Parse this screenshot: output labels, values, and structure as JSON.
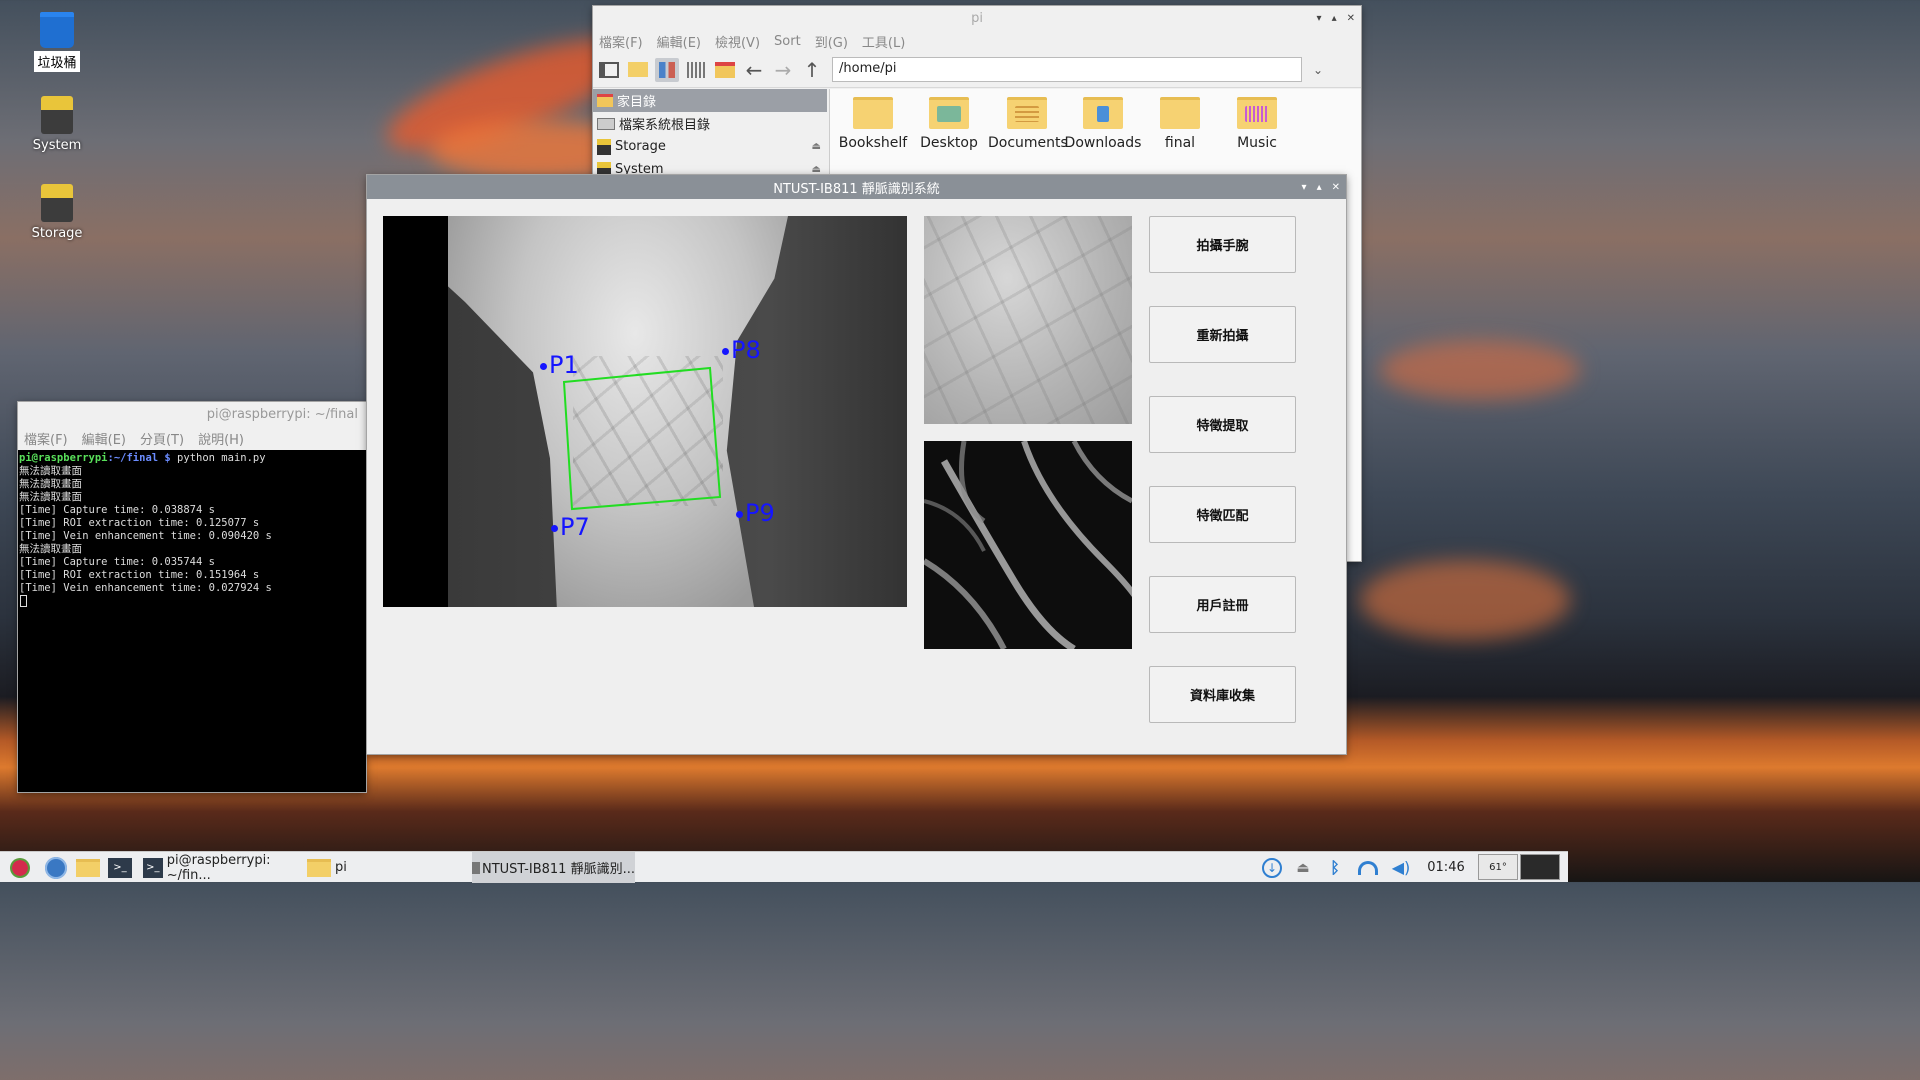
{
  "desktop": {
    "icons": [
      {
        "label": "垃圾桶"
      },
      {
        "label": "System"
      },
      {
        "label": "Storage"
      }
    ]
  },
  "file_manager": {
    "title": "pi",
    "menu": [
      "檔案(F)",
      "編輯(E)",
      "檢視(V)",
      "Sort",
      "到(G)",
      "工具(L)"
    ],
    "path": "/home/pi",
    "sidebar": [
      {
        "label": "家目錄"
      },
      {
        "label": "檔案系統根目錄"
      },
      {
        "label": "Storage"
      },
      {
        "label": "System"
      }
    ],
    "files": [
      {
        "label": "Bookshelf"
      },
      {
        "label": "Desktop"
      },
      {
        "label": "Documents"
      },
      {
        "label": "Downloads"
      },
      {
        "label": "final"
      },
      {
        "label": "Music"
      }
    ]
  },
  "terminal": {
    "title": "pi@raspberrypi: ~/final",
    "menu": [
      "檔案(F)",
      "編輯(E)",
      "分頁(T)",
      "說明(H)"
    ],
    "prompt_user": "pi@raspberrypi",
    "prompt_path": ":~/final $",
    "command": " python main.py",
    "lines": [
      "無法讀取畫面",
      "無法讀取畫面",
      "無法讀取畫面",
      "[Time] Capture time: 0.038874 s",
      "[Time] ROI extraction time: 0.125077 s",
      "[Time] Vein enhancement time: 0.090420 s",
      "無法讀取畫面",
      "[Time] Capture time: 0.035744 s",
      "[Time] ROI extraction time: 0.151964 s",
      "[Time] Vein enhancement time: 0.027924 s"
    ]
  },
  "app": {
    "title": "NTUST-IB811 靜脈識別系統",
    "points": {
      "p1": "P1",
      "p7": "P7",
      "p8": "P8",
      "p9": "P9"
    },
    "buttons": {
      "capture": "拍攝手腕",
      "retake": "重新拍攝",
      "extract": "特徵提取",
      "match": "特徵匹配",
      "register": "用戶註冊",
      "collect": "資料庫收集"
    }
  },
  "taskbar": {
    "tasks": [
      {
        "label": "pi@raspberrypi: ~/fin..."
      },
      {
        "label": "pi"
      },
      {
        "label": "NTUST-IB811 靜脈識別..."
      }
    ],
    "clock": "01:46",
    "cpu": "61°"
  }
}
